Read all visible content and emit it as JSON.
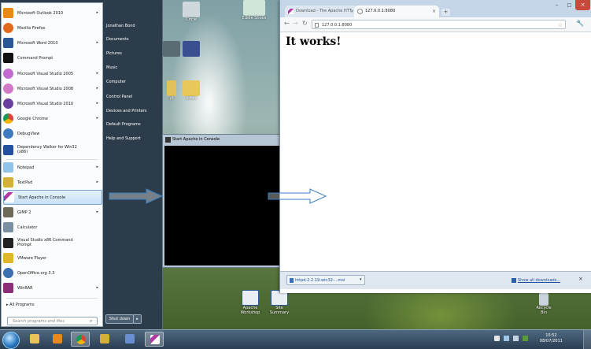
{
  "start_menu": {
    "programs": [
      {
        "label": "Microsoft Outlook 2010",
        "icon": "outlook-icon",
        "color": "#e88a1a",
        "arrow": true
      },
      {
        "label": "Mozilla Firefox",
        "icon": "firefox-icon",
        "color": "#e36a1c",
        "arrow": false
      },
      {
        "label": "Microsoft Word 2010",
        "icon": "word-icon",
        "color": "#2b5797",
        "arrow": true
      },
      {
        "label": "Command Prompt",
        "icon": "cmd-icon",
        "color": "#111111",
        "arrow": false
      },
      {
        "label": "Microsoft Visual Studio 2005",
        "icon": "vs2005-icon",
        "color": "#c26bd0",
        "arrow": true
      },
      {
        "label": "Microsoft Visual Studio 2008",
        "icon": "vs2008-icon",
        "color": "#d27ac8",
        "arrow": true
      },
      {
        "label": "Microsoft Visual Studio 2010",
        "icon": "vs2010-icon",
        "color": "#6a3fa0",
        "arrow": true
      },
      {
        "label": "Google Chrome",
        "icon": "chrome-icon",
        "color": "#3aa757",
        "arrow": true
      },
      {
        "label": "DebugView",
        "icon": "debugview-icon",
        "color": "#3d7abf",
        "arrow": false
      },
      {
        "label": "Dependency Walker for Win32 (x86)",
        "icon": "depends-icon",
        "color": "#2450a0",
        "arrow": false
      },
      {
        "label": "Notepad",
        "icon": "notepad-icon",
        "color": "#8fc3e8",
        "arrow": true
      },
      {
        "label": "TextPad",
        "icon": "textpad-icon",
        "color": "#d4b03b",
        "arrow": true
      },
      {
        "label": "Start Apache in Console",
        "icon": "apache-feather-icon",
        "color": "#b23aa0",
        "arrow": false
      },
      {
        "label": "GIMP 2",
        "icon": "gimp-icon",
        "color": "#6e6a5a",
        "arrow": true
      },
      {
        "label": "Calculator",
        "icon": "calculator-icon",
        "color": "#7b8fa3",
        "arrow": false
      },
      {
        "label": "Visual Studio x86 Command Prompt",
        "icon": "vs-cmd-icon",
        "color": "#222222",
        "arrow": false
      },
      {
        "label": "VMware Player",
        "icon": "vmware-icon",
        "color": "#e0b72b",
        "arrow": false
      },
      {
        "label": "OpenOffice.org 3.3",
        "icon": "openoffice-icon",
        "color": "#3b6fb0",
        "arrow": false
      },
      {
        "label": "WinRAR",
        "icon": "winrar-icon",
        "color": "#8a2f77",
        "arrow": true
      }
    ],
    "all_programs": "All Programs",
    "search_placeholder": "Search programs and files",
    "right_items": [
      "Jonathan Bond",
      "Documents",
      "Pictures",
      "Music",
      "Computer",
      "Control Panel",
      "Devices and Printers",
      "Default Programs",
      "Help and Support"
    ],
    "shutdown": "Shut down",
    "shutdown_arrow": "▸"
  },
  "desktop": {
    "icons": [
      {
        "label": "Circle",
        "color": "#cfd8dc"
      },
      {
        "label": "Eddie Shoes",
        "color": "#d0e6d8"
      },
      {
        "label": "",
        "color": "#5a6b73"
      },
      {
        "label": "",
        "color": "#3a4f8f"
      },
      {
        "label": "yt",
        "color": "#e2c15a"
      },
      {
        "label": "notes",
        "color": "#e8c85a"
      },
      {
        "label": "Apache Workshop",
        "color": "#e9eef5"
      },
      {
        "label": "Site Summary",
        "color": "#e9eef5"
      },
      {
        "label": "Recycle Bin",
        "color": "#c9d4de"
      }
    ]
  },
  "console": {
    "title": "Start Apache in Console"
  },
  "browser": {
    "tabs": [
      {
        "title": "Download - The Apache HTT",
        "active": false
      },
      {
        "title": "127.0.0.1:8080",
        "active": true
      }
    ],
    "tab_close": "×",
    "new_tab": "+",
    "window_buttons": [
      "–",
      "□",
      "×"
    ],
    "back": "←",
    "forward": "→",
    "reload": "↻",
    "url": "127.0.0.1:8080",
    "star": "☆",
    "wrench": "🔧",
    "page_heading": "It works!",
    "download_item": "httpd-2.2.19-win32-...msi",
    "show_all_downloads": "Show all downloads...",
    "download_close": "×"
  },
  "taskbar": {
    "time": "10:52",
    "date": "08/07/2011",
    "items": [
      {
        "name": "explorer-icon",
        "color": "#e7c35a",
        "active": false
      },
      {
        "name": "outlook-icon",
        "color": "#e88a1a",
        "active": false
      },
      {
        "name": "chrome-icon",
        "color": "#3aa757",
        "active": true
      },
      {
        "name": "visual-studio-icon",
        "color": "#d4b03b",
        "active": false
      },
      {
        "name": "vs-window-icon",
        "color": "#6a8fd0",
        "active": false
      },
      {
        "name": "apache-feather-icon",
        "color": "#b23aa0",
        "active": true
      }
    ]
  }
}
